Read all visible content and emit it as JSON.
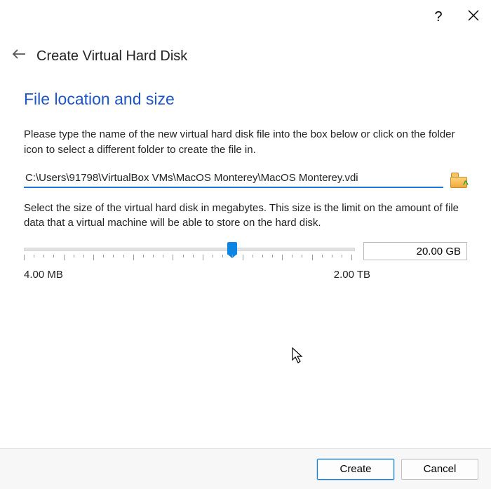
{
  "window": {
    "title": "Create Virtual Hard Disk"
  },
  "section": {
    "title": "File location and size",
    "location_instruction": "Please type the name of the new virtual hard disk file into the box below or click on the folder icon to select a different folder to create the file in.",
    "size_instruction": "Select the size of the virtual hard disk in megabytes. This size is the limit on the amount of file data that a virtual machine will be able to store on the hard disk."
  },
  "path": {
    "value": "C:\\Users\\91798\\VirtualBox VMs\\MacOS Monterey\\MacOS Monterey.vdi"
  },
  "size": {
    "value": "20.00 GB",
    "min_label": "4.00 MB",
    "max_label": "2.00 TB",
    "thumb_percent": 63
  },
  "buttons": {
    "create": "Create",
    "cancel": "Cancel"
  }
}
